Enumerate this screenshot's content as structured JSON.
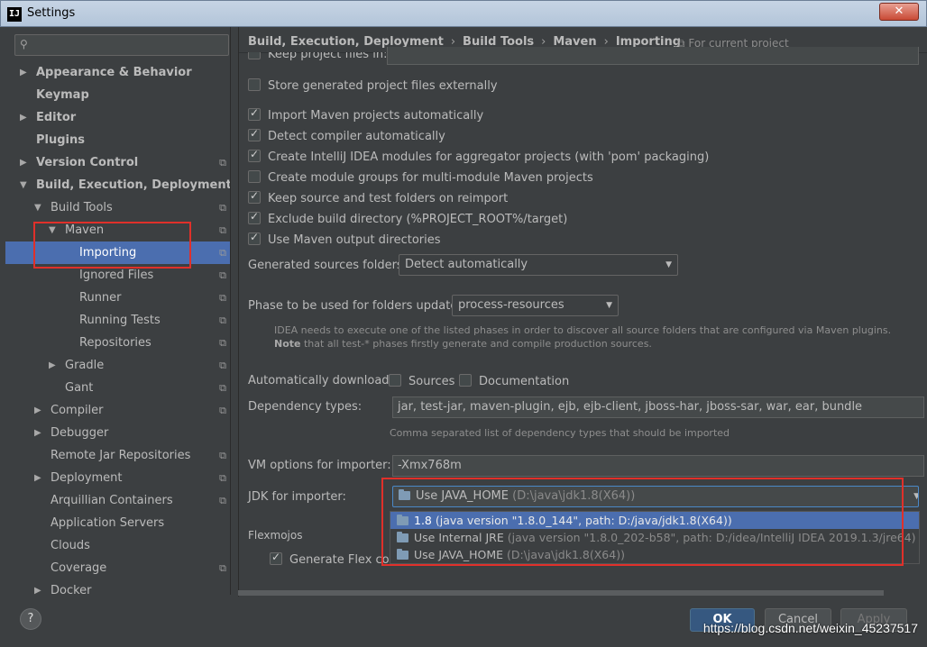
{
  "window": {
    "app_icon": "IJ",
    "title": "Settings",
    "close_label": "✕"
  },
  "sidebar": {
    "search_placeholder": "",
    "items": [
      {
        "label": "Appearance & Behavior",
        "arrow": "▶",
        "indent": 0,
        "bold": true,
        "proj": ""
      },
      {
        "label": "Keymap",
        "arrow": "",
        "indent": 0,
        "bold": true,
        "proj": ""
      },
      {
        "label": "Editor",
        "arrow": "▶",
        "indent": 0,
        "bold": true,
        "proj": ""
      },
      {
        "label": "Plugins",
        "arrow": "",
        "indent": 0,
        "bold": true,
        "proj": ""
      },
      {
        "label": "Version Control",
        "arrow": "▶",
        "indent": 0,
        "bold": true,
        "proj": "⧉"
      },
      {
        "label": "Build, Execution, Deployment",
        "arrow": "▼",
        "indent": 0,
        "bold": true,
        "proj": ""
      },
      {
        "label": "Build Tools",
        "arrow": "▼",
        "indent": 1,
        "bold": false,
        "proj": "⧉"
      },
      {
        "label": "Maven",
        "arrow": "▼",
        "indent": 2,
        "bold": false,
        "proj": "⧉"
      },
      {
        "label": "Importing",
        "arrow": "",
        "indent": 3,
        "bold": false,
        "proj": "⧉",
        "selected": true
      },
      {
        "label": "Ignored Files",
        "arrow": "",
        "indent": 3,
        "bold": false,
        "proj": "⧉"
      },
      {
        "label": "Runner",
        "arrow": "",
        "indent": 3,
        "bold": false,
        "proj": "⧉"
      },
      {
        "label": "Running Tests",
        "arrow": "",
        "indent": 3,
        "bold": false,
        "proj": "⧉"
      },
      {
        "label": "Repositories",
        "arrow": "",
        "indent": 3,
        "bold": false,
        "proj": "⧉"
      },
      {
        "label": "Gradle",
        "arrow": "▶",
        "indent": 2,
        "bold": false,
        "proj": "⧉"
      },
      {
        "label": "Gant",
        "arrow": "",
        "indent": 2,
        "bold": false,
        "proj": "⧉"
      },
      {
        "label": "Compiler",
        "arrow": "▶",
        "indent": 1,
        "bold": false,
        "proj": "⧉"
      },
      {
        "label": "Debugger",
        "arrow": "▶",
        "indent": 1,
        "bold": false,
        "proj": ""
      },
      {
        "label": "Remote Jar Repositories",
        "arrow": "",
        "indent": 1,
        "bold": false,
        "proj": "⧉"
      },
      {
        "label": "Deployment",
        "arrow": "▶",
        "indent": 1,
        "bold": false,
        "proj": "⧉"
      },
      {
        "label": "Arquillian Containers",
        "arrow": "",
        "indent": 1,
        "bold": false,
        "proj": "⧉"
      },
      {
        "label": "Application Servers",
        "arrow": "",
        "indent": 1,
        "bold": false,
        "proj": ""
      },
      {
        "label": "Clouds",
        "arrow": "",
        "indent": 1,
        "bold": false,
        "proj": ""
      },
      {
        "label": "Coverage",
        "arrow": "",
        "indent": 1,
        "bold": false,
        "proj": "⧉"
      },
      {
        "label": "Docker",
        "arrow": "▶",
        "indent": 1,
        "bold": false,
        "proj": ""
      }
    ]
  },
  "breadcrumb": {
    "parts": [
      "Build, Execution, Deployment",
      "Build Tools",
      "Maven",
      "Importing"
    ],
    "separator": "›",
    "for_project": "⧉ For current project"
  },
  "importing": {
    "keep_files_partial": "Keep project files in:",
    "store_externally": "Store generated project files externally",
    "options": [
      {
        "label": "Import Maven projects automatically",
        "checked": true
      },
      {
        "label": "Detect compiler automatically",
        "checked": true
      },
      {
        "label": "Create IntelliJ IDEA modules for aggregator projects (with 'pom' packaging)",
        "checked": true
      },
      {
        "label": "Create module groups for multi-module Maven projects",
        "checked": false
      },
      {
        "label": "Keep source and test folders on reimport",
        "checked": true
      },
      {
        "label": "Exclude build directory (%PROJECT_ROOT%/target)",
        "checked": true
      },
      {
        "label": "Use Maven output directories",
        "checked": true
      }
    ],
    "gen_sources_label": "Generated sources folders:",
    "gen_sources_value": "Detect automatically",
    "phase_label": "Phase to be used for folders update:",
    "phase_value": "process-resources",
    "phase_note_1": "IDEA needs to execute one of the listed phases in order to discover all source folders that are configured via Maven plugins.",
    "phase_note_2_bold": "Note",
    "phase_note_2": " that all test-* phases firstly generate and compile production sources.",
    "auto_download_label": "Automatically download:",
    "sources_label": "Sources",
    "documentation_label": "Documentation",
    "dep_types_label": "Dependency types:",
    "dep_types_value": "jar, test-jar, maven-plugin, ejb, ejb-client, jboss-har, jboss-sar, war, ear, bundle",
    "dep_types_hint": "Comma separated list of dependency types that should be imported",
    "vm_options_label": "VM options for importer:",
    "vm_options_value": "-Xmx768m",
    "jdk_label": "JDK for importer:",
    "jdk_value_main": "Use JAVA_HOME",
    "jdk_value_dim": " (D:\\java\\jdk1.8(X64))",
    "jdk_options": [
      {
        "main": "1.8",
        "dim": " (java version \"1.8.0_144\", path: D:/java/jdk1.8(X64))",
        "selected": true
      },
      {
        "main": "Use Internal JRE",
        "dim": " (java version \"1.8.0_202-b58\", path: D:/idea/IntelliJ IDEA 2019.1.3/jre64)",
        "selected": false
      },
      {
        "main": "Use JAVA_HOME",
        "dim": " (D:\\java\\jdk1.8(X64))",
        "selected": false
      }
    ],
    "flexmojos_label": "Flexmojos",
    "generate_flex_label": "Generate Flex comp"
  },
  "footer": {
    "help": "?",
    "ok": "OK",
    "cancel": "Cancel",
    "apply": "Apply",
    "watermark": "https://blog.csdn.net/weixin_45237517"
  },
  "colors": {
    "highlight": "#e0302a",
    "selection": "#4b6eaf",
    "background": "#3c3f41"
  }
}
